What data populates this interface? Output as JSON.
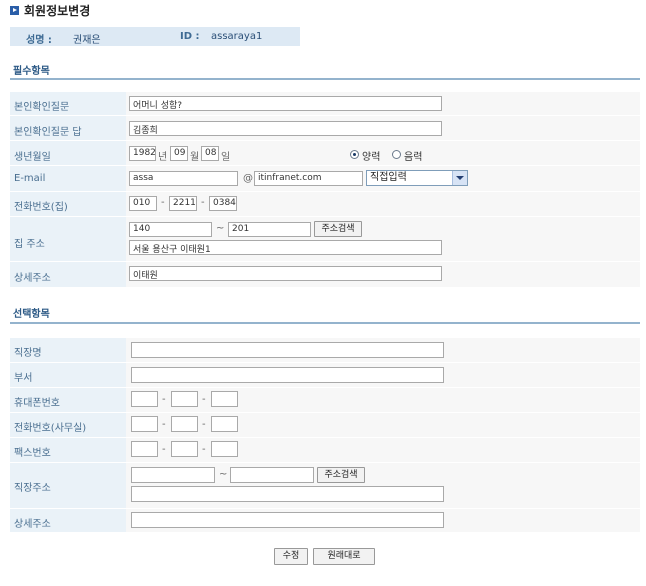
{
  "page_title": "회원정보변경",
  "member": {
    "name_label": "성명 :",
    "name": "권재은",
    "id_label": "ID :",
    "id": "assaraya1"
  },
  "required": {
    "title": "필수항목",
    "q_label": "본인확인질문",
    "q_value": "어머니 성함?",
    "a_label": "본인확인질문 답",
    "a_value": "김종희",
    "birth_label": "생년월일",
    "birth_year": "1982",
    "year_unit": "년",
    "birth_month": "09",
    "month_unit": "월",
    "birth_day": "08",
    "day_unit": "일",
    "solar_label": "양력",
    "lunar_label": "음력",
    "email_label": "E-mail",
    "email_id": "assa",
    "email_at": "@",
    "email_domain": "itinfranet.com",
    "email_select": "직접입력",
    "phone_label": "전화번호(집)",
    "phone1": "010",
    "phone2": "2211",
    "phone3": "0384",
    "addr_label": "집 주소",
    "zip1": "140",
    "zip_sep": "~",
    "zip2": "201",
    "addr_search": "주소검색",
    "addr_value": "서울 용산구 이태원1",
    "detail_label": "상세주소",
    "detail_value": "이태원"
  },
  "optional": {
    "title": "선택항목",
    "company_label": "직장명",
    "dept_label": "부서",
    "mobile_label": "휴대폰번호",
    "office_phone_label": "전화번호(사무실)",
    "fax_label": "팩스번호",
    "work_addr_label": "직장주소",
    "zip_sep": "~",
    "addr_search": "주소검색",
    "detail_label": "상세주소",
    "dash": "-"
  },
  "buttons": {
    "submit": "수정",
    "reset": "원래대로"
  }
}
